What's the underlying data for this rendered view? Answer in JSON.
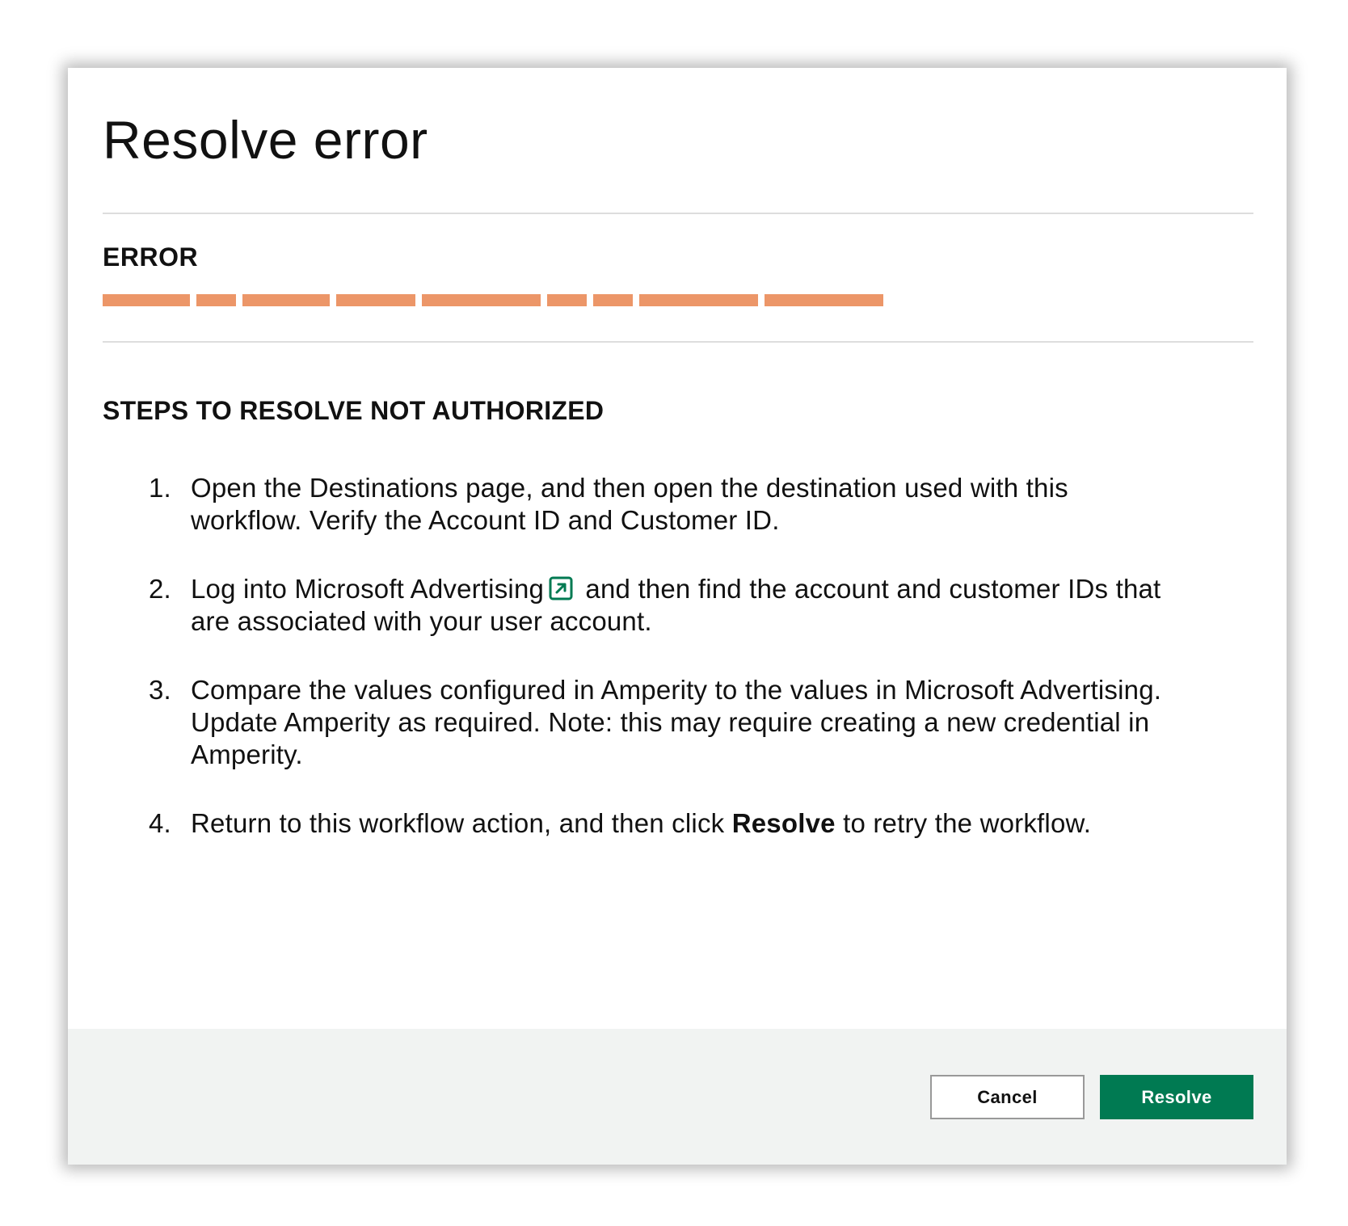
{
  "dialog": {
    "title": "Resolve error"
  },
  "error_section": {
    "label": "ERROR",
    "redacted_text_color": "#ec9668"
  },
  "steps_section": {
    "heading": "STEPS TO RESOLVE NOT AUTHORIZED",
    "steps": [
      {
        "number": "1.",
        "text": "Open the Destinations page, and then open the destination used with this workflow. Verify the Account ID and Customer ID."
      },
      {
        "number": "2.",
        "text_before_link": "Log into Microsoft Advertising",
        "link_icon": "external-link-icon",
        "text_after_link": " and then find the account and customer IDs that are associated with your user account."
      },
      {
        "number": "3.",
        "text": "Compare the values configured in Amperity to the values in Microsoft Advertising. Update Amperity as required. Note: this may require creating a new credential in Amperity."
      },
      {
        "number": "4.",
        "text_before_bold": "Return to this workflow action, and then click ",
        "bold": "Resolve",
        "text_after_bold": " to retry the workflow."
      }
    ]
  },
  "footer": {
    "cancel_label": "Cancel",
    "resolve_label": "Resolve"
  },
  "colors": {
    "accent": "#007a52",
    "redaction": "#ec9668",
    "footer_bg": "#f1f3f2"
  }
}
